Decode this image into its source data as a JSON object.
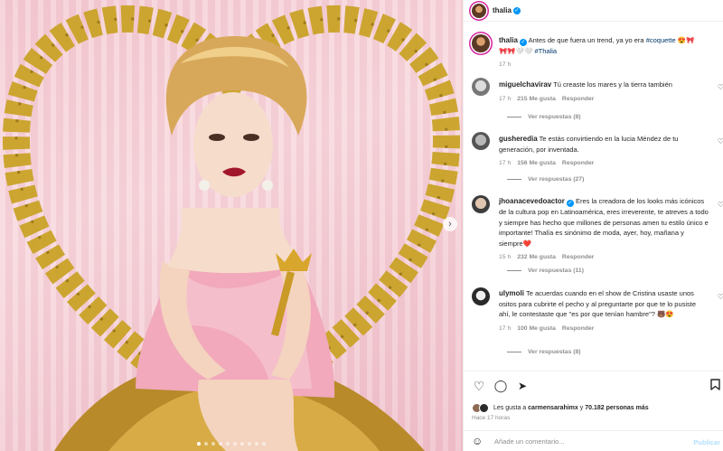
{
  "post": {
    "author": "thalia",
    "caption": {
      "text": "Antes de que fuera un trend, ya yo era",
      "hashtag1": "#coquette",
      "emoji_line1": "😍🎀",
      "emoji_line2": "🎀🎀🤍🤍",
      "hashtag2": "#Thalia"
    },
    "time": "17 h"
  },
  "comments": [
    {
      "user": "miguelchavirav",
      "text": "Tú creaste los mares y la tierra también",
      "time": "17 h",
      "likes": "215 Me gusta",
      "reply_label": "Responder",
      "view_replies": "Ver respuestas (8)"
    },
    {
      "user": "gusheredia",
      "text": "Te estás convirtiendo en la lucia Méndez de tu generación, por inventada.",
      "time": "17 h",
      "likes": "156 Me gusta",
      "reply_label": "Responder",
      "view_replies": "Ver respuestas (27)"
    },
    {
      "user": "jhoanacevedoactor",
      "text": "Eres la creadora de los looks más icónicos de la cultura pop en Latinoamérica, eres irreverente, te atreves a todo y siempre has hecho que millones de personas amen tu estilo único e importante! Thalía es sinónimo de moda, ayer, hoy, mañana y siempre❤️",
      "time": "15 h",
      "likes": "232 Me gusta",
      "reply_label": "Responder",
      "view_replies": "Ver respuestas (11)"
    },
    {
      "user": "ulymoli",
      "text": "Te acuerdas cuando en el show de Cristina usaste unos ositos para cubrirte el pecho y al preguntarte por que te lo pusiste ahí, le contestaste que \"es por que tenían hambre\"? 🐻😍",
      "time": "17 h",
      "likes": "100 Me gusta",
      "reply_label": "Responder",
      "view_replies": "Ver respuestas (8)"
    }
  ],
  "likes_summary": {
    "prefix": "Les gusta a",
    "user": "carmensarahimx",
    "middle": "y",
    "count": "70.182 personas más"
  },
  "time_ago": "Hace 17 horas",
  "composer": {
    "placeholder": "Añade un comentario...",
    "post_label": "Publicar"
  },
  "icons": {
    "like": "heart-outline",
    "comment": "speech-bubble",
    "share": "paper-plane",
    "save": "bookmark",
    "emoji": "smiley",
    "next": "chevron-right"
  },
  "colors": {
    "verified": "#0095f6",
    "link": "#00376b",
    "muted": "#8e8e8e",
    "text": "#262626",
    "post_disabled": "#b2dffc"
  },
  "carousel": {
    "total_slides": 10,
    "active_slide": 1
  }
}
